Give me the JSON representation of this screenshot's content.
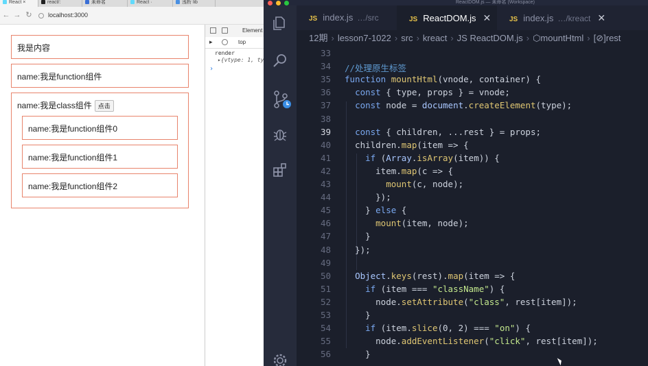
{
  "browser": {
    "tabs": [
      {
        "label": "React ×",
        "active": true,
        "color": "#61dafb"
      },
      {
        "label": "react/:",
        "active": false,
        "color": "#222222"
      },
      {
        "label": "未命名",
        "active": false,
        "color": "#3b6fd6"
      },
      {
        "label": "React ·",
        "active": false,
        "color": "#61dafb"
      },
      {
        "label": "浅析 lib",
        "active": false,
        "color": "#4a90e2"
      }
    ],
    "url": "localhost:3000",
    "page": {
      "content_box": "我是内容",
      "function_box": "name:我是function组件",
      "class_box_label": "name:我是class组件",
      "class_box_button": "点击",
      "children": [
        "name:我是function组件0",
        "name:我是function组件1",
        "name:我是function组件2"
      ]
    },
    "devtools": {
      "tab_elements": "Element",
      "context": "top",
      "console_lines": [
        {
          "text": "render",
          "color": "#333333"
        },
        {
          "text": "▸{vtype: 1, typ",
          "color": "#555555"
        },
        {
          "text": "›",
          "color": "#2b7be0"
        }
      ]
    }
  },
  "editor": {
    "window_title": "ReactDOM.js — 未命名 (Workspace)",
    "tabs": [
      {
        "name": "index.js",
        "desc": "…/src",
        "active": false,
        "close": ""
      },
      {
        "name": "ReactDOM.js",
        "desc": "",
        "active": true,
        "close": "✕"
      },
      {
        "name": "index.js",
        "desc": "…/kreact",
        "active": false,
        "close": "✕"
      }
    ],
    "breadcrumb": [
      "12期",
      "lesson7-1022",
      "src",
      "kreact",
      "JS ReactDOM.js",
      "⬡mountHtml",
      "[⊘]rest"
    ],
    "current_line": 39,
    "line_numbers": [
      33,
      34,
      35,
      36,
      37,
      38,
      39,
      40,
      41,
      42,
      43,
      44,
      45,
      46,
      47,
      48,
      49,
      50,
      51,
      52,
      53,
      54,
      55,
      56
    ],
    "code_lines": [
      "",
      "//处理原生标签",
      "function mountHtml(vnode, container) {",
      "  const { type, props } = vnode;",
      "  const node = document.createElement(type);",
      "",
      "  const { children, ...rest } = props;",
      "  children.map(item => {",
      "    if (Array.isArray(item)) {",
      "      item.map(c => {",
      "        mount(c, node);",
      "      });",
      "    } else {",
      "      mount(item, node);",
      "    }",
      "  });",
      "",
      "  Object.keys(rest).map(item => {",
      "    if (item === \"className\") {",
      "      node.setAttribute(\"class\", rest[item]);",
      "    }",
      "    if (item.slice(0, 2) === \"on\") {",
      "      node.addEventListener(\"click\", rest[item]);",
      "    }"
    ],
    "activity_icons": [
      "files-icon",
      "search-icon",
      "source-control-icon",
      "debug-icon",
      "extensions-icon",
      "settings-gear-icon"
    ]
  }
}
